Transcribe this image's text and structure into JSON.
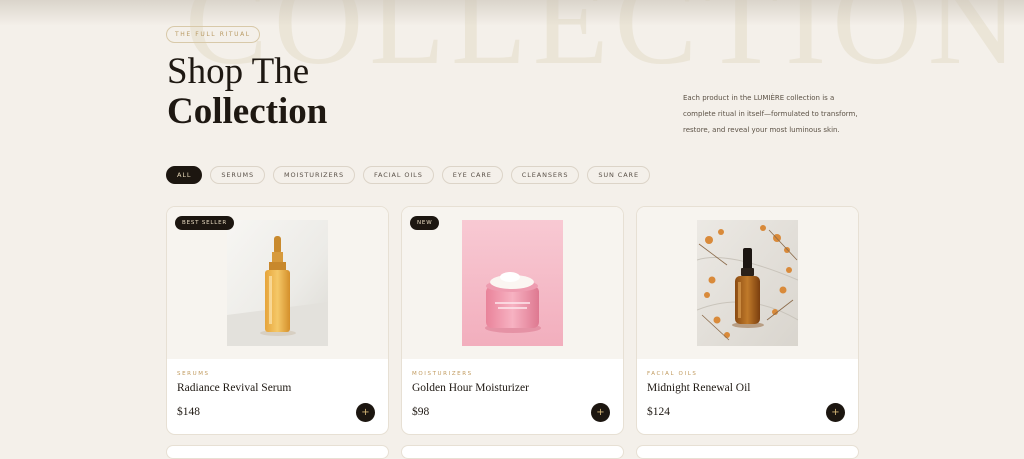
{
  "hero": {
    "background_word": "COLLECTION",
    "eyebrow": "THE FULL RITUAL",
    "title_line1": "Shop The",
    "title_line2": "Collection",
    "intro": "Each product in the LUMIÈRE collection is a complete ritual in itself—formulated to transform, restore, and reveal your most luminous skin."
  },
  "filters": [
    {
      "label": "ALL",
      "active": true
    },
    {
      "label": "SERUMS",
      "active": false
    },
    {
      "label": "MOISTURIZERS",
      "active": false
    },
    {
      "label": "FACIAL OILS",
      "active": false
    },
    {
      "label": "EYE CARE",
      "active": false
    },
    {
      "label": "CLEANSERS",
      "active": false
    },
    {
      "label": "SUN CARE",
      "active": false
    }
  ],
  "products": [
    {
      "badge": "BEST SELLER",
      "category": "SERUMS",
      "name": "Radiance Revival Serum",
      "price": "$148",
      "add_icon": "plus-icon"
    },
    {
      "badge": "NEW",
      "category": "MOISTURIZERS",
      "name": "Golden Hour Moisturizer",
      "price": "$98",
      "add_icon": "plus-icon"
    },
    {
      "badge": "",
      "category": "FACIAL OILS",
      "name": "Midnight Renewal Oil",
      "price": "$124",
      "add_icon": "plus-icon"
    }
  ],
  "colors": {
    "background": "#f4f0ea",
    "dark": "#1c1610",
    "gold": "#c09a5e",
    "card": "#ffffff"
  }
}
